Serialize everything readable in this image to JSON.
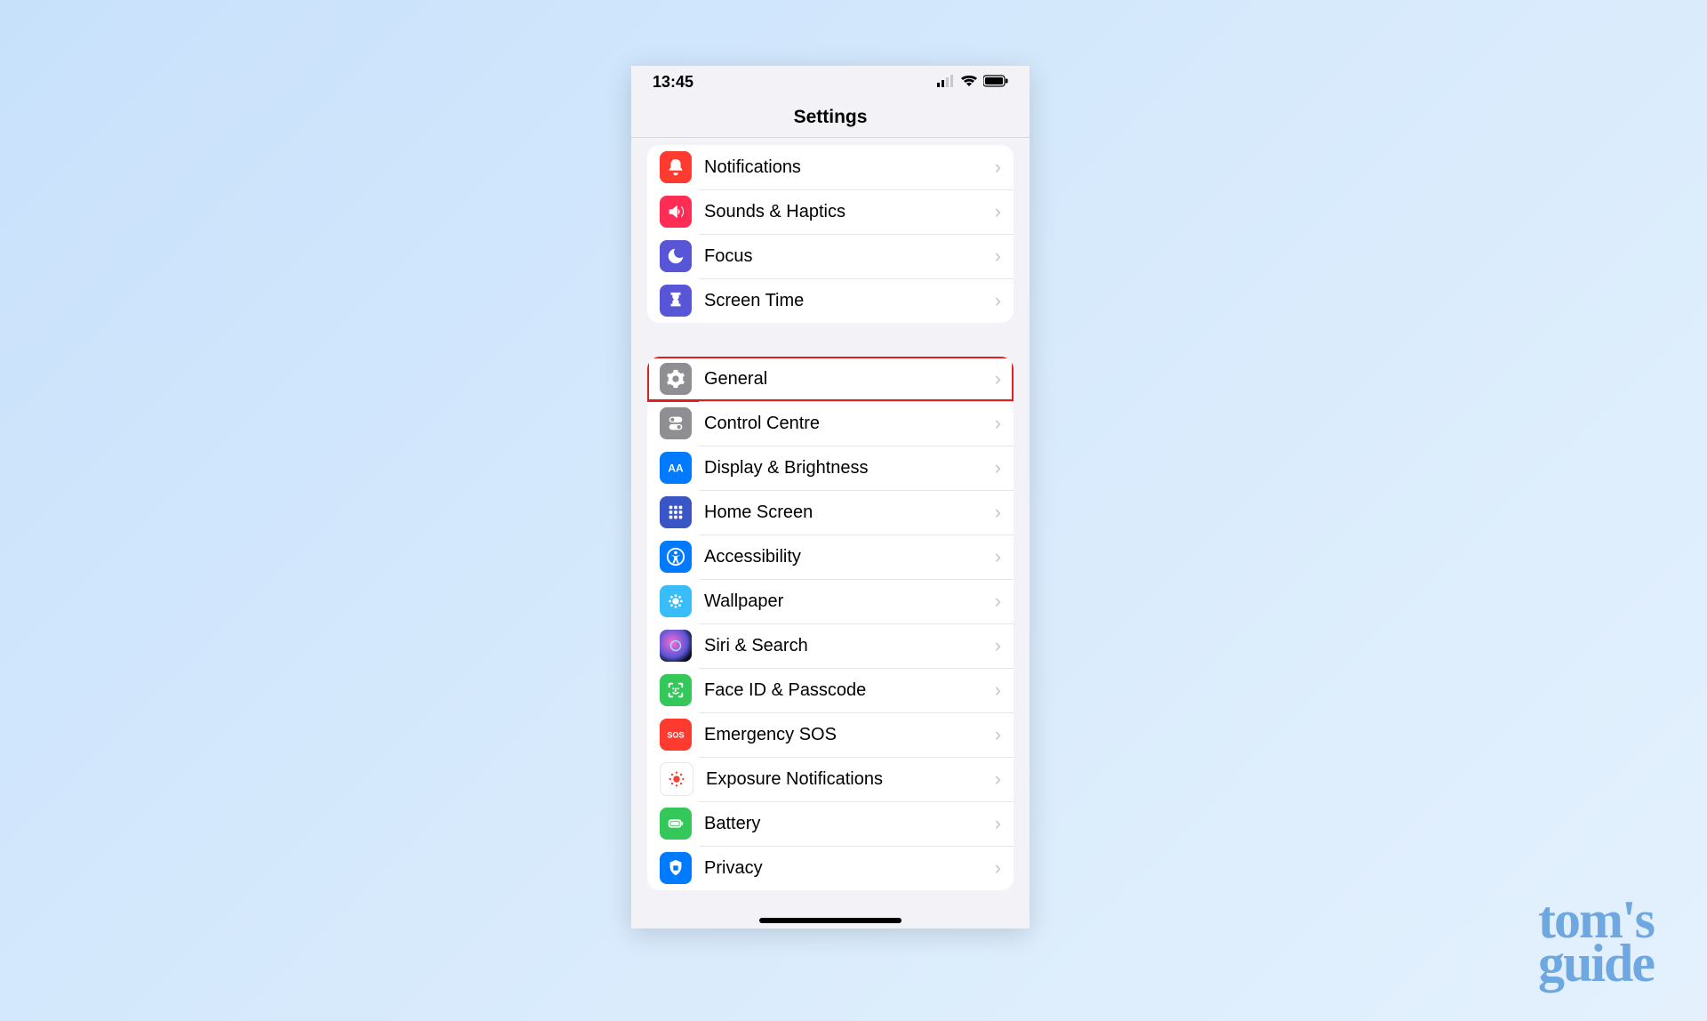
{
  "statusbar": {
    "time": "13:45"
  },
  "page_title": "Settings",
  "groups": [
    {
      "rows": [
        {
          "key": "notifications",
          "label": "Notifications",
          "color": "#ff3b30",
          "highlight": false
        },
        {
          "key": "sounds",
          "label": "Sounds & Haptics",
          "color": "#ff2d55",
          "highlight": false
        },
        {
          "key": "focus",
          "label": "Focus",
          "color": "#5856d6",
          "highlight": false
        },
        {
          "key": "screentime",
          "label": "Screen Time",
          "color": "#5856d6",
          "highlight": false
        }
      ]
    },
    {
      "rows": [
        {
          "key": "general",
          "label": "General",
          "color": "#8e8e93",
          "highlight": true
        },
        {
          "key": "controlcentre",
          "label": "Control Centre",
          "color": "#8e8e93",
          "highlight": false
        },
        {
          "key": "display",
          "label": "Display & Brightness",
          "color": "#007aff",
          "highlight": false
        },
        {
          "key": "homescreen",
          "label": "Home Screen",
          "color": "#3955c6",
          "highlight": false
        },
        {
          "key": "accessibility",
          "label": "Accessibility",
          "color": "#007aff",
          "highlight": false
        },
        {
          "key": "wallpaper",
          "label": "Wallpaper",
          "color": "#38bdf8",
          "highlight": false
        },
        {
          "key": "siri",
          "label": "Siri & Search",
          "color": "#1e1e3f",
          "highlight": false
        },
        {
          "key": "faceid",
          "label": "Face ID & Passcode",
          "color": "#34c759",
          "highlight": false
        },
        {
          "key": "sos",
          "label": "Emergency SOS",
          "color": "#ff3b30",
          "highlight": false
        },
        {
          "key": "exposure",
          "label": "Exposure Notifications",
          "color": "#ffffff",
          "highlight": false
        },
        {
          "key": "battery",
          "label": "Battery",
          "color": "#34c759",
          "highlight": false
        },
        {
          "key": "privacy",
          "label": "Privacy",
          "color": "#007aff",
          "highlight": false
        }
      ]
    }
  ],
  "watermark": {
    "line1": "tom's",
    "line2": "guide"
  }
}
